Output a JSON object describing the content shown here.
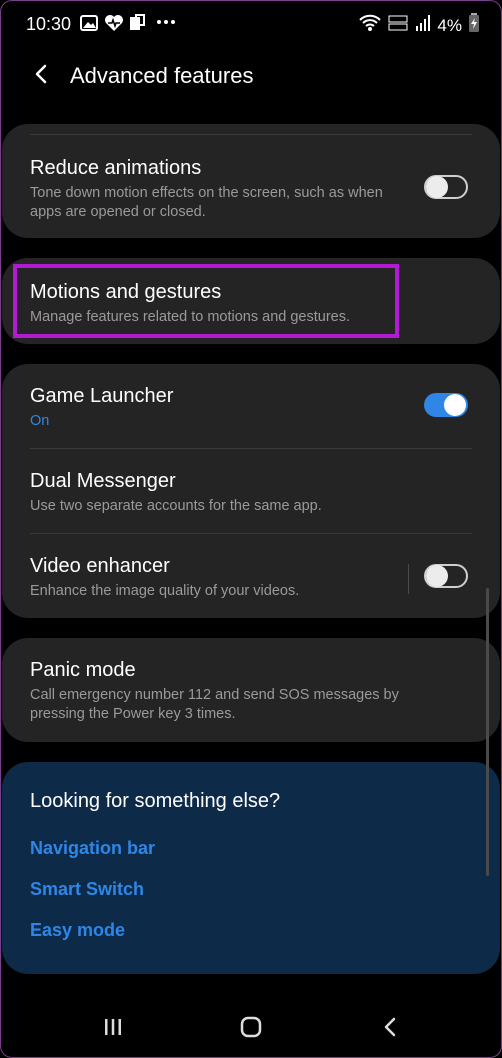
{
  "status": {
    "time": "10:30",
    "battery": "4%"
  },
  "header": {
    "title": "Advanced features"
  },
  "card1": {
    "title": "Reduce animations",
    "subtitle": "Tone down motion effects on the screen, such as when apps are opened or closed.",
    "toggle_on": false
  },
  "card2": {
    "title": "Motions and gestures",
    "subtitle": "Manage features related to motions and gestures."
  },
  "card3": {
    "game": {
      "title": "Game Launcher",
      "subtitle": "On",
      "toggle_on": true
    },
    "dual": {
      "title": "Dual Messenger",
      "subtitle": "Use two separate accounts for the same app."
    },
    "video": {
      "title": "Video enhancer",
      "subtitle": "Enhance the image quality of your videos.",
      "toggle_on": false
    }
  },
  "card4": {
    "title": "Panic mode",
    "subtitle": "Call emergency number 112 and send SOS messages by pressing the Power key 3 times."
  },
  "suggestions": {
    "heading": "Looking for something else?",
    "links": [
      "Navigation bar",
      "Smart Switch",
      "Easy mode"
    ]
  },
  "colors": {
    "accent": "#2f86e6",
    "highlight": "#b21ad6",
    "card": "#242424",
    "suggest_bg": "#0d2b48"
  },
  "icons": [
    "image-icon",
    "health-icon",
    "sim-icon",
    "more-icon",
    "wifi-icon",
    "signal-icon",
    "battery-icon",
    "back-arrow-icon",
    "recents-icon",
    "home-icon",
    "nav-back-icon"
  ]
}
